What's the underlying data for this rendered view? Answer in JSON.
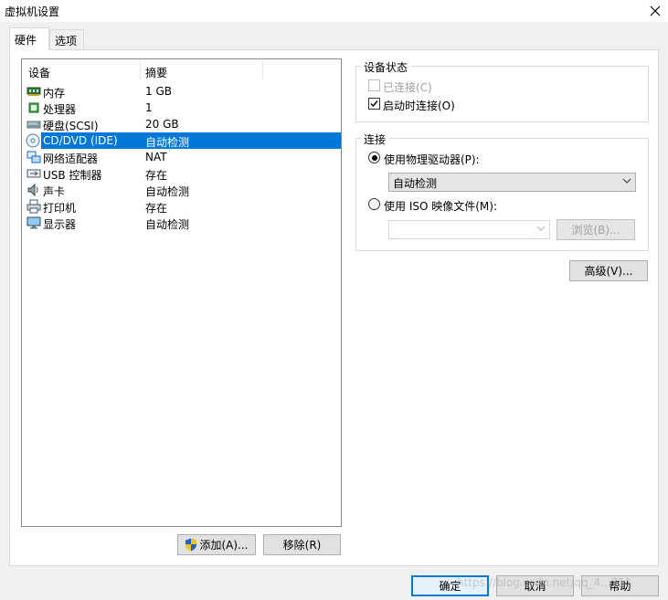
{
  "window": {
    "title": "虚拟机设置"
  },
  "tabs": [
    {
      "label": "硬件"
    },
    {
      "label": "选项"
    }
  ],
  "device_list": {
    "columns": [
      "设备",
      "摘要"
    ],
    "rows": [
      {
        "name": "内存",
        "summary": "1 GB",
        "icon": "memory-icon"
      },
      {
        "name": "处理器",
        "summary": "1",
        "icon": "processor-icon"
      },
      {
        "name": "硬盘(SCSI)",
        "summary": "20 GB",
        "icon": "hard-disk-icon"
      },
      {
        "name": "CD/DVD (IDE)",
        "summary": "自动检测",
        "icon": "cd-dvd-icon",
        "selected": true
      },
      {
        "name": "网络适配器",
        "summary": "NAT",
        "icon": "network-adapter-icon"
      },
      {
        "name": "USB 控制器",
        "summary": "存在",
        "icon": "usb-controller-icon"
      },
      {
        "name": "声卡",
        "summary": "自动检测",
        "icon": "sound-card-icon"
      },
      {
        "name": "打印机",
        "summary": "存在",
        "icon": "printer-icon"
      },
      {
        "name": "显示器",
        "summary": "自动检测",
        "icon": "display-icon"
      }
    ]
  },
  "list_buttons": {
    "add": "添加(A)...",
    "remove": "移除(R)"
  },
  "device_status": {
    "legend": "设备状态",
    "connected_label": "已连接(C)",
    "connected_checked": false,
    "connect_on_power_label": "启动时连接(O)",
    "connect_on_power_checked": true
  },
  "connection": {
    "legend": "连接",
    "physical_label": "使用物理驱动器(P):",
    "physical_selected": true,
    "physical_value": "自动检测",
    "iso_label": "使用 ISO 映像文件(M):",
    "iso_selected": false,
    "iso_value": "",
    "browse_label": "浏览(B)..."
  },
  "advanced_label": "高级(V)...",
  "footer": {
    "ok": "确定",
    "cancel": "取消",
    "help": "帮助"
  },
  "watermark": "https://blog.csdn.net/qq_4...711",
  "colors": {
    "selection": "#0078d7",
    "panel": "#ffffff",
    "background": "#f0f0f0"
  }
}
